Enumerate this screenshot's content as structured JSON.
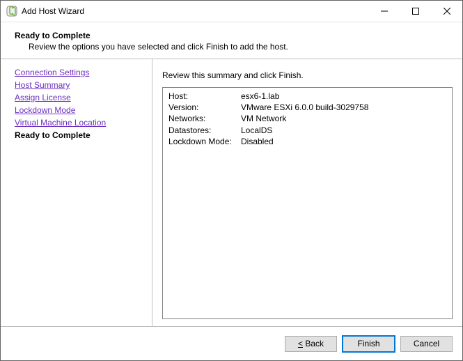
{
  "window": {
    "title": "Add Host Wizard"
  },
  "header": {
    "title": "Ready to Complete",
    "subtitle": "Review the options you have selected and click Finish to add the host."
  },
  "sidebar": {
    "steps": [
      {
        "label": "Connection Settings",
        "current": false
      },
      {
        "label": "Host Summary",
        "current": false
      },
      {
        "label": "Assign License",
        "current": false
      },
      {
        "label": "Lockdown Mode",
        "current": false
      },
      {
        "label": "Virtual Machine Location",
        "current": false
      },
      {
        "label": "Ready to Complete",
        "current": true
      }
    ]
  },
  "main": {
    "instruction": "Review this summary and click Finish.",
    "summary": [
      {
        "label": "Host:",
        "value": "esx6-1.lab"
      },
      {
        "label": "Version:",
        "value": "VMware ESXi 6.0.0 build-3029758"
      },
      {
        "label": "Networks:",
        "value": "VM Network"
      },
      {
        "label": "Datastores:",
        "value": "LocalDS"
      },
      {
        "label": "Lockdown Mode:",
        "value": "Disabled"
      }
    ]
  },
  "footer": {
    "back_accel": "<",
    "back_label": " Back",
    "finish_label": "Finish",
    "cancel_label": "Cancel"
  }
}
